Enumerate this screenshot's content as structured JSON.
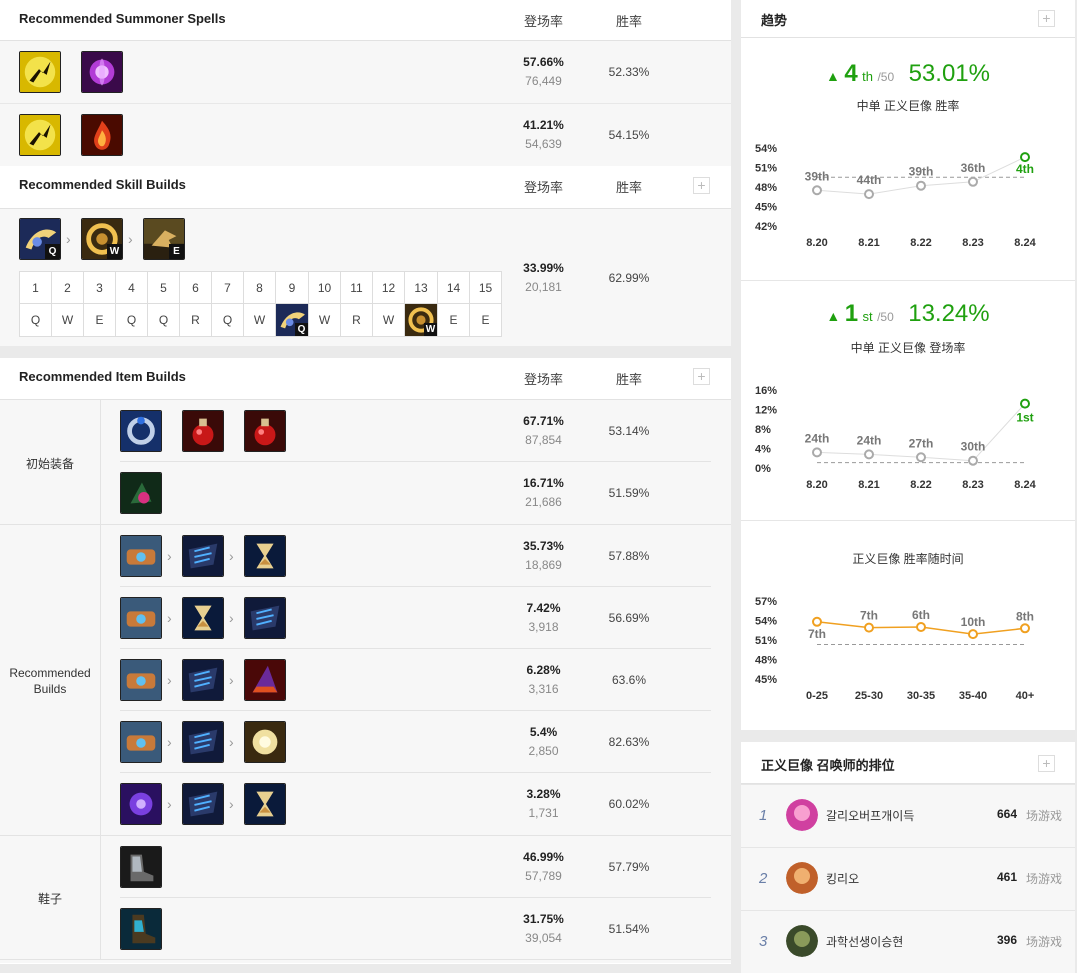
{
  "headers": {
    "pickrate": "登场率",
    "winrate": "胜率"
  },
  "summoner": {
    "title": "Recommended Summoner Spells",
    "rows": [
      {
        "spells": [
          "flash-spell-icon",
          "teleport-spell-icon"
        ],
        "pick": "57.66%",
        "count": "76,449",
        "win": "52.33%"
      },
      {
        "spells": [
          "flash-spell-icon",
          "ignite-spell-icon"
        ],
        "pick": "41.21%",
        "count": "54,639",
        "win": "54.15%"
      }
    ]
  },
  "skills": {
    "title": "Recommended Skill Builds",
    "order": [
      {
        "icon": "q-skill-icon",
        "key": "Q"
      },
      {
        "icon": "w-skill-icon",
        "key": "W"
      },
      {
        "icon": "e-skill-icon",
        "key": "E"
      }
    ],
    "levels": [
      "1",
      "2",
      "3",
      "4",
      "5",
      "6",
      "7",
      "8",
      "9",
      "10",
      "11",
      "12",
      "13",
      "14",
      "15"
    ],
    "sequence": [
      "Q",
      "W",
      "E",
      "Q",
      "Q",
      "R",
      "Q",
      "W",
      "Q",
      "W",
      "R",
      "W",
      "W",
      "E",
      "E"
    ],
    "pick": "33.99%",
    "count": "20,181",
    "win": "62.99%"
  },
  "items": {
    "title": "Recommended Item Builds",
    "groups": [
      {
        "label": "初始装备",
        "rows": [
          {
            "items": [
              "doran-ring-icon",
              "health-potion-icon",
              "health-potion-icon"
            ],
            "pick": "67.71%",
            "count": "87,854",
            "win": "53.14%"
          },
          {
            "items": [
              "corrupting-potion-icon"
            ],
            "pick": "16.71%",
            "count": "21,686",
            "win": "51.59%"
          }
        ]
      },
      {
        "label": "Recommended Builds",
        "rows": [
          {
            "items": [
              "hextech-protobelt-icon",
              "void-staff-icon",
              "zhonya-hourglass-icon"
            ],
            "pick": "35.73%",
            "count": "18,869",
            "win": "57.88%"
          },
          {
            "items": [
              "hextech-protobelt-icon",
              "zhonya-hourglass-icon",
              "void-staff-icon"
            ],
            "pick": "7.42%",
            "count": "3,918",
            "win": "56.69%"
          },
          {
            "items": [
              "hextech-protobelt-icon",
              "void-staff-icon",
              "rabadon-deathcap-icon"
            ],
            "pick": "6.28%",
            "count": "3,316",
            "win": "63.6%"
          },
          {
            "items": [
              "hextech-protobelt-icon",
              "void-staff-icon",
              "banshee-veil-icon"
            ],
            "pick": "5.4%",
            "count": "2,850",
            "win": "82.63%"
          },
          {
            "items": [
              "luden-echo-icon",
              "void-staff-icon",
              "zhonya-hourglass-icon"
            ],
            "pick": "3.28%",
            "count": "1,731",
            "win": "60.02%"
          }
        ]
      },
      {
        "label": "鞋子",
        "rows": [
          {
            "items": [
              "sorcerer-shoes-icon"
            ],
            "pick": "46.99%",
            "count": "57,789",
            "win": "57.79%"
          },
          {
            "items": [
              "mercury-treads-icon"
            ],
            "pick": "31.75%",
            "count": "39,054",
            "win": "51.54%"
          }
        ]
      }
    ]
  },
  "trend": {
    "title": "趋势",
    "winrate_card": {
      "rank": "4",
      "rank_suffix": "th",
      "of": "/50",
      "value": "53.01%",
      "caption": "中单 正义巨像 胜率"
    },
    "pickrate_card": {
      "rank": "1",
      "rank_suffix": "st",
      "of": "/50",
      "value": "13.24%",
      "caption": "中单 正义巨像 登场率"
    },
    "time_caption": "正义巨像 胜率随时间"
  },
  "chart_data": [
    {
      "type": "line",
      "x": [
        "8.20",
        "8.21",
        "8.22",
        "8.23",
        "8.24"
      ],
      "y_ticks": [
        "54%",
        "51%",
        "48%",
        "45%",
        "42%"
      ],
      "ylim": [
        42,
        54
      ],
      "series": [
        {
          "values": [
            47.5,
            46.9,
            48.2,
            48.8,
            52.6
          ]
        }
      ],
      "point_labels": [
        "39th",
        "44th",
        "39th",
        "36th",
        "4th"
      ],
      "reference_line": 49.5
    },
    {
      "type": "line",
      "x": [
        "8.20",
        "8.21",
        "8.22",
        "8.23",
        "8.24"
      ],
      "y_ticks": [
        "16%",
        "12%",
        "8%",
        "4%",
        "0%"
      ],
      "ylim": [
        0,
        16
      ],
      "series": [
        {
          "values": [
            3.2,
            2.8,
            2.2,
            1.5,
            13.2
          ]
        }
      ],
      "point_labels": [
        "24th",
        "24th",
        "27th",
        "30th",
        "1st"
      ],
      "reference_line": 1.1
    },
    {
      "type": "line",
      "x": [
        "0-25",
        "25-30",
        "30-35",
        "35-40",
        "40+"
      ],
      "y_ticks": [
        "57%",
        "54%",
        "51%",
        "48%",
        "45%"
      ],
      "ylim": [
        45,
        57
      ],
      "series": [
        {
          "values": [
            53.8,
            52.9,
            53.0,
            51.9,
            52.8
          ]
        }
      ],
      "point_labels": [
        "7th",
        "7th",
        "6th",
        "10th",
        "8th"
      ],
      "reference_line": 50.3
    }
  ],
  "ranking": {
    "title": "正义巨像 召唤师的排位",
    "games_label": "场游戏",
    "players": [
      {
        "rank": "1",
        "name": "갈리오버프개이득",
        "games": "664"
      },
      {
        "rank": "2",
        "name": "킹리오",
        "games": "461"
      },
      {
        "rank": "3",
        "name": "과학선생이승현",
        "games": "396"
      }
    ]
  }
}
